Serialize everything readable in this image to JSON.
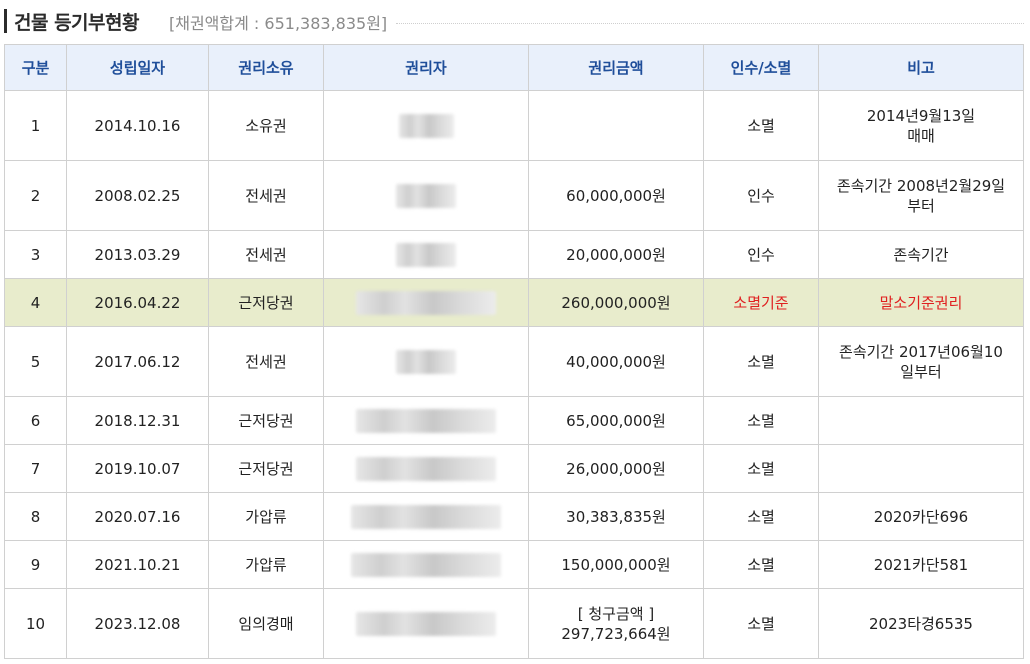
{
  "header": {
    "title": "건물 등기부현황",
    "summary": "[채권액합계 : 651,383,835원]"
  },
  "table": {
    "columns": [
      "구분",
      "성립일자",
      "권리소유",
      "권리자",
      "권리금액",
      "인수/소멸",
      "비고"
    ],
    "rows": [
      {
        "no": "1",
        "date": "2014.10.16",
        "type": "소유권",
        "amount_lines": [
          ""
        ],
        "status": "소멸",
        "note_lines": [
          "2014년9월13일",
          "매매"
        ],
        "blur": 55,
        "highlight": false
      },
      {
        "no": "2",
        "date": "2008.02.25",
        "type": "전세권",
        "amount_lines": [
          "60,000,000원"
        ],
        "status": "인수",
        "note_lines": [
          "존속기간 2008년2월29일",
          "부터"
        ],
        "blur": 60,
        "highlight": false
      },
      {
        "no": "3",
        "date": "2013.03.29",
        "type": "전세권",
        "amount_lines": [
          "20,000,000원"
        ],
        "status": "인수",
        "note_lines": [
          "존속기간"
        ],
        "blur": 60,
        "highlight": false
      },
      {
        "no": "4",
        "date": "2016.04.22",
        "type": "근저당권",
        "amount_lines": [
          "260,000,000원"
        ],
        "status": "소멸기준",
        "note_lines": [
          "말소기준권리"
        ],
        "blur": 140,
        "highlight": true
      },
      {
        "no": "5",
        "date": "2017.06.12",
        "type": "전세권",
        "amount_lines": [
          "40,000,000원"
        ],
        "status": "소멸",
        "note_lines": [
          "존속기간 2017년06월10",
          "일부터"
        ],
        "blur": 60,
        "highlight": false
      },
      {
        "no": "6",
        "date": "2018.12.31",
        "type": "근저당권",
        "amount_lines": [
          "65,000,000원"
        ],
        "status": "소멸",
        "note_lines": [
          ""
        ],
        "blur": 140,
        "highlight": false
      },
      {
        "no": "7",
        "date": "2019.10.07",
        "type": "근저당권",
        "amount_lines": [
          "26,000,000원"
        ],
        "status": "소멸",
        "note_lines": [
          ""
        ],
        "blur": 140,
        "highlight": false
      },
      {
        "no": "8",
        "date": "2020.07.16",
        "type": "가압류",
        "amount_lines": [
          "30,383,835원"
        ],
        "status": "소멸",
        "note_lines": [
          "2020카단696"
        ],
        "blur": 150,
        "highlight": false
      },
      {
        "no": "9",
        "date": "2021.10.21",
        "type": "가압류",
        "amount_lines": [
          "150,000,000원"
        ],
        "status": "소멸",
        "note_lines": [
          "2021카단581"
        ],
        "blur": 150,
        "highlight": false
      },
      {
        "no": "10",
        "date": "2023.12.08",
        "type": "임의경매",
        "amount_lines": [
          "[ 청구금액 ]",
          "297,723,664원"
        ],
        "status": "소멸",
        "note_lines": [
          "2023타경6535"
        ],
        "blur": 140,
        "highlight": false
      }
    ]
  }
}
